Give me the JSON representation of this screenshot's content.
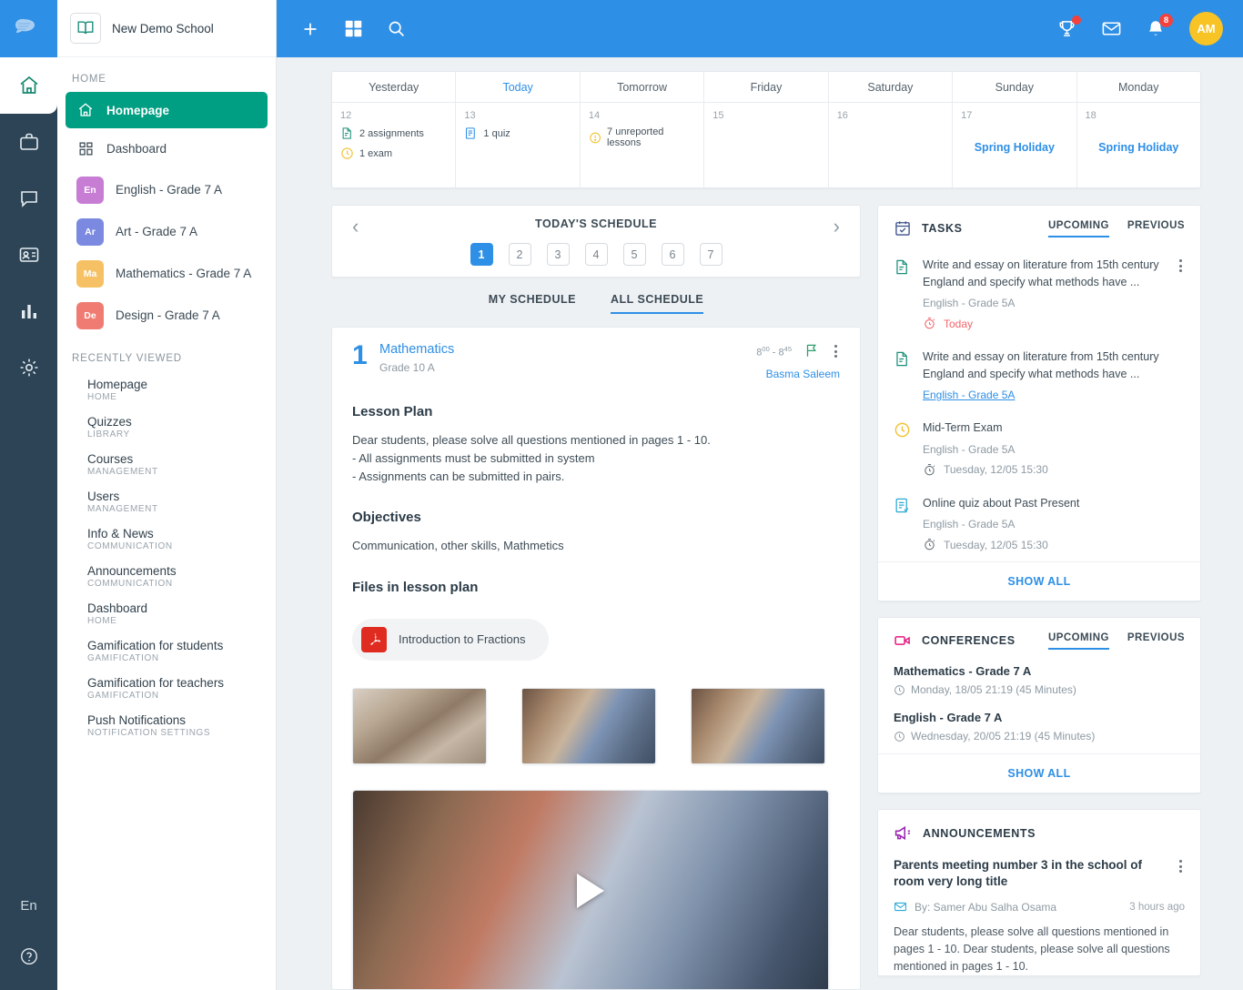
{
  "rail": {
    "items": [
      {
        "name": "home",
        "active": true
      },
      {
        "name": "briefcase",
        "active": false
      },
      {
        "name": "chat",
        "active": false
      },
      {
        "name": "id-card",
        "active": false
      },
      {
        "name": "chart",
        "active": false
      },
      {
        "name": "gear",
        "active": false
      }
    ],
    "language": "En",
    "help_label": "?"
  },
  "sidebar": {
    "school_name": "New Demo School",
    "home_section_label": "HOME",
    "nav": [
      {
        "label": "Homepage",
        "icon": "home-icon",
        "active": true
      },
      {
        "label": "Dashboard",
        "icon": "grid-icon",
        "active": false
      }
    ],
    "courses": [
      {
        "abbr": "En",
        "label": "English - Grade 7 A",
        "color": "#c77dd4"
      },
      {
        "abbr": "Ar",
        "label": "Art - Grade 7 A",
        "color": "#7b8ae0"
      },
      {
        "abbr": "Ma",
        "label": "Mathematics - Grade 7 A",
        "color": "#f5c164"
      },
      {
        "abbr": "De",
        "label": "Design - Grade 7 A",
        "color": "#f07b72"
      }
    ],
    "recently_viewed_label": "RECENTLY VIEWED",
    "recently_viewed": [
      {
        "title": "Homepage",
        "sub": "HOME"
      },
      {
        "title": "Quizzes",
        "sub": "LIBRARY"
      },
      {
        "title": "Courses",
        "sub": "MANAGEMENT"
      },
      {
        "title": "Users",
        "sub": "MANAGEMENT"
      },
      {
        "title": "Info & News",
        "sub": "COMMUNICATION"
      },
      {
        "title": "Announcements",
        "sub": "COMMUNICATION"
      },
      {
        "title": "Dashboard",
        "sub": "HOME"
      },
      {
        "title": "Gamification for students",
        "sub": "GAMIFICATION"
      },
      {
        "title": "Gamification for teachers",
        "sub": "GAMIFICATION"
      },
      {
        "title": "Push Notifications",
        "sub": "NOTIFICATION SETTINGS"
      }
    ]
  },
  "topbar": {
    "add_icon": "plus-icon",
    "apps_icon": "grid-icon",
    "search_icon": "search-icon",
    "trophy_icon": "trophy-icon",
    "trophy_badge": "",
    "mail_icon": "mail-icon",
    "bell_icon": "bell-icon",
    "bell_badge": "8",
    "avatar_initials": "AM",
    "accent": "#2e8fe6"
  },
  "week": [
    {
      "label": "Yesterday",
      "today": false,
      "num": "12",
      "events": [
        {
          "icon": "assignment-icon",
          "text": "2 assignments",
          "color": "#1a8f7a"
        },
        {
          "icon": "clock-icon",
          "text": "1 exam",
          "color": "#f2c230"
        }
      ],
      "holiday": ""
    },
    {
      "label": "Today",
      "today": true,
      "num": "13",
      "events": [
        {
          "icon": "quiz-icon",
          "text": "1 quiz",
          "color": "#2e8fe6"
        }
      ],
      "holiday": ""
    },
    {
      "label": "Tomorrow",
      "today": false,
      "num": "14",
      "events": [
        {
          "icon": "warning-icon",
          "text": "7 unreported lessons",
          "color": "#f2c230"
        }
      ],
      "holiday": ""
    },
    {
      "label": "Friday",
      "today": false,
      "num": "15",
      "events": [],
      "holiday": ""
    },
    {
      "label": "Saturday",
      "today": false,
      "num": "16",
      "events": [],
      "holiday": ""
    },
    {
      "label": "Sunday",
      "today": false,
      "num": "17",
      "events": [],
      "holiday": "Spring Holiday"
    },
    {
      "label": "Monday",
      "today": false,
      "num": "18",
      "events": [],
      "holiday": "Spring Holiday"
    }
  ],
  "schedule": {
    "title": "TODAY'S SCHEDULE",
    "pages": [
      "1",
      "2",
      "3",
      "4",
      "5",
      "6",
      "7"
    ],
    "active_page": "1",
    "tabs": [
      {
        "label": "MY SCHEDULE",
        "active": false
      },
      {
        "label": "ALL SCHEDULE",
        "active": true
      }
    ]
  },
  "lesson": {
    "number": "1",
    "subject": "Mathematics",
    "grade": "Grade 10 A",
    "time_start_hour": "8",
    "time_start_min": "00",
    "time_end_hour": "8",
    "time_end_min": "45",
    "teacher": "Basma Saleem",
    "flag_icon": "flag-icon",
    "menu_icon": "kebab-icon",
    "plan_heading": "Lesson Plan",
    "plan_lines": [
      "Dear students, please solve all questions mentioned in pages 1 - 10.",
      "- All assignments must be submitted in system",
      "- Assignments can be submitted in pairs."
    ],
    "objectives_heading": "Objectives",
    "objectives_text": "Communication, other skills, Mathmetics",
    "files_heading": "Files in lesson plan",
    "file_name": "Introduction to Fractions",
    "file_type": "pdf",
    "thumbnails": [
      "classroom-kids-laptop",
      "kids-tablets-1",
      "kids-tablets-2"
    ],
    "video_label": "lesson-video"
  },
  "tasks": {
    "title": "TASKS",
    "icon": "calendar-check-icon",
    "tabs": [
      {
        "label": "UPCOMING",
        "active": true
      },
      {
        "label": "PREVIOUS",
        "active": false
      }
    ],
    "items": [
      {
        "icon": "assignment-icon",
        "title": "Write and essay on literature from 15th century England and specify what methods have ...",
        "sub": "English - Grade 5A",
        "sub_link": false,
        "when": "Today",
        "when_icon": "timer-icon",
        "when_today": true,
        "has_menu": true
      },
      {
        "icon": "assignment-icon",
        "title": "Write and essay on literature from 15th century England and specify what methods have ...",
        "sub": "English - Grade 5A",
        "sub_link": true,
        "when": "",
        "when_icon": "",
        "when_today": false,
        "has_menu": false
      },
      {
        "icon": "clock-icon",
        "title": "Mid-Term Exam",
        "sub": "English - Grade 5A",
        "sub_link": false,
        "when": "Tuesday, 12/05 15:30",
        "when_icon": "timer-icon",
        "when_today": false,
        "has_menu": false
      },
      {
        "icon": "quiz-icon",
        "title": "Online quiz about Past Present",
        "sub": "English - Grade 5A",
        "sub_link": false,
        "when": "Tuesday, 12/05 15:30",
        "when_icon": "timer-icon",
        "when_today": false,
        "has_menu": false
      }
    ],
    "show_all": "SHOW ALL"
  },
  "conferences": {
    "title": "CONFERENCES",
    "icon": "video-camera-icon",
    "tabs": [
      {
        "label": "UPCOMING",
        "active": true
      },
      {
        "label": "PREVIOUS",
        "active": false
      }
    ],
    "items": [
      {
        "title": "Mathematics - Grade 7 A",
        "when": "Monday, 18/05 21:19 (45 Minutes)"
      },
      {
        "title": "English - Grade 7 A",
        "when": "Wednesday, 20/05 21:19 (45 Minutes)"
      }
    ],
    "show_all": "SHOW ALL"
  },
  "announcements": {
    "title": "ANNOUNCEMENTS",
    "icon": "megaphone-icon",
    "item_title": "Parents meeting number 3 in the school of room very long title",
    "author": "By: Samer Abu Salha Osama",
    "ago": "3 hours ago",
    "text": "Dear students, please solve all questions mentioned in pages 1 - 10.  Dear students, please solve all questions mentioned in pages 1 - 10."
  }
}
